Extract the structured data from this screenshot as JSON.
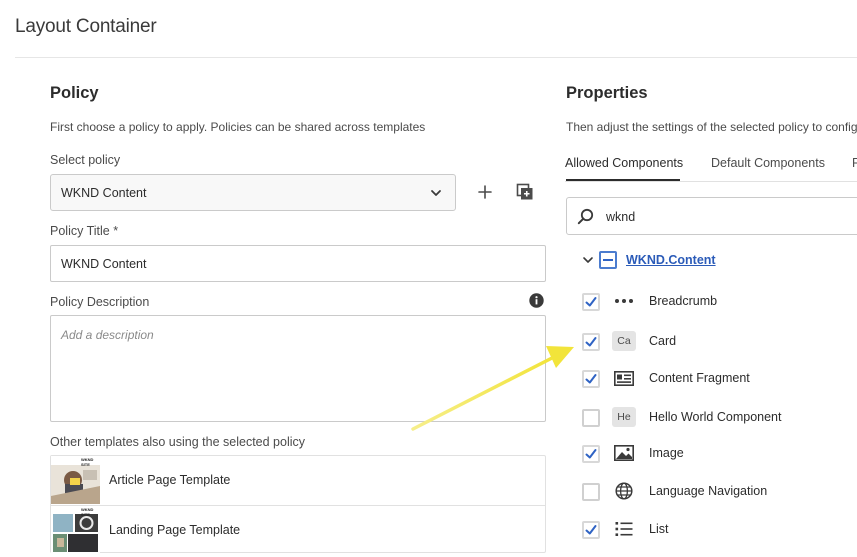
{
  "page": {
    "title": "Layout Container"
  },
  "policy": {
    "heading": "Policy",
    "helper": "First choose a policy to apply. Policies can be shared across templates",
    "select_label": "Select policy",
    "selected_policy": "WKND Content",
    "title_label": "Policy Title *",
    "title_value": "WKND Content",
    "description_label": "Policy Description",
    "description_placeholder": "Add a description",
    "templates_label": "Other templates also using the selected policy",
    "templates": [
      {
        "name": "Article Page Template",
        "thumb_label": "WKND SITE"
      },
      {
        "name": "Landing Page Template",
        "thumb_label": "WKND SITE"
      }
    ]
  },
  "properties": {
    "heading": "Properties",
    "helper": "Then adjust the settings of the selected policy to configure",
    "tabs": [
      {
        "label": "Allowed Components",
        "active": true
      },
      {
        "label": "Default Components",
        "active": false
      },
      {
        "label": "R",
        "active": false
      }
    ],
    "search_value": "wknd",
    "group": {
      "label": "WKND.Content",
      "state": "partial"
    },
    "components": [
      {
        "label": "Breadcrumb",
        "checked": true,
        "icon": "more-dots-icon"
      },
      {
        "label": "Card",
        "checked": true,
        "icon": "abbr",
        "abbr": "Ca"
      },
      {
        "label": "Content Fragment",
        "checked": true,
        "icon": "content-fragment-icon"
      },
      {
        "label": "Hello World Component",
        "checked": false,
        "icon": "abbr",
        "abbr": "He"
      },
      {
        "label": "Image",
        "checked": true,
        "icon": "image-icon"
      },
      {
        "label": "Language Navigation",
        "checked": false,
        "icon": "globe-icon"
      },
      {
        "label": "List",
        "checked": true,
        "icon": "list-icon"
      }
    ]
  },
  "colors": {
    "accent": "#2b5bb8",
    "arrow": "#f2e43a",
    "checkmark": "#2f63c4"
  }
}
